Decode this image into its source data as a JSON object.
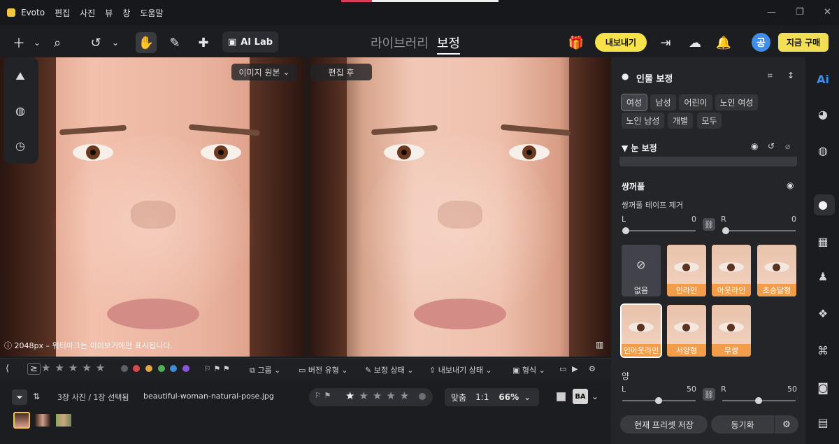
{
  "app": {
    "title": "Evoto",
    "menus": [
      "편집",
      "사진",
      "뷰",
      "창",
      "도움말"
    ]
  },
  "toolbar": {
    "ai_lab": "AI Lab",
    "tabs": [
      "라이브러리",
      "보정"
    ],
    "active_tab": "보정",
    "export": "내보내기",
    "buy": "지금 구매",
    "avatar": "공"
  },
  "viewer": {
    "original_label": "이미지 원본",
    "after_label": "편집 후",
    "resolution_note": "ⓘ 2048px – 워터마크는 이미보기에만 표시됩니다."
  },
  "bottom": {
    "filters": [
      "그룹",
      "버전 유형",
      "보정 상태",
      "내보내기 상태",
      "형식"
    ],
    "info": "3장 사진 / 1장 선택됨",
    "filename": "beautiful-woman-natural-pose.jpg",
    "fit": "맞춤",
    "one_to_one": "1:1",
    "zoom": "66%",
    "compare": "BA"
  },
  "panel": {
    "title": "인물 보정",
    "chips": [
      "여성",
      "남성",
      "어린이",
      "노인 여성",
      "노인 남성",
      "개별",
      "모두"
    ],
    "selected_chip": "여성",
    "eye_section": "눈 보정",
    "double_lid": "쌍꺼풀",
    "double_lid_tape": "쌍꺼풀 테이프 제거",
    "left_label": "L",
    "right_label": "R",
    "tape_l": "0",
    "tape_r": "0",
    "presets": [
      "없음",
      "인라인",
      "아웃라인",
      "초승달형",
      "인아웃라인",
      "서양형",
      "무쌍"
    ],
    "selected_preset": "인아웃라인",
    "amount": "양",
    "amount_l": "50",
    "amount_r": "50",
    "save_preset": "현재 프리셋 저장",
    "sync": "동기화"
  },
  "colors": {
    "accent": "#f7e24a",
    "preset_caption": "#f29d49",
    "panel_bg": "#242529",
    "avatar": "#3f8ee9"
  }
}
